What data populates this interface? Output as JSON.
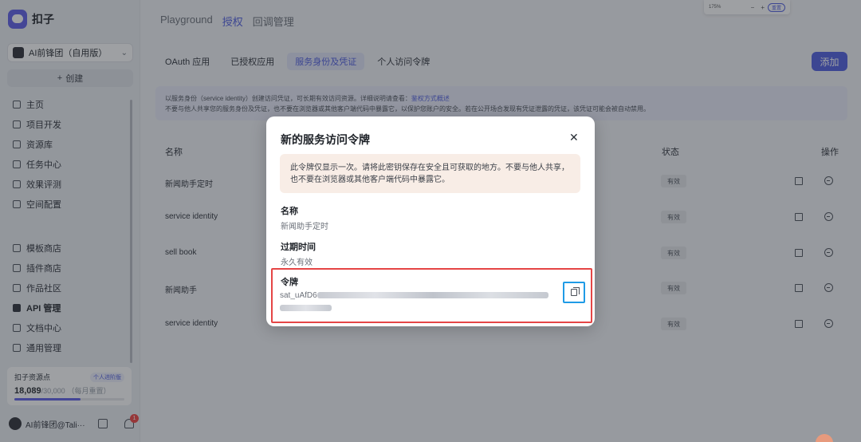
{
  "app": {
    "name": "扣子"
  },
  "workspace": {
    "name": "AI前锋团（自用版）"
  },
  "sidebar": {
    "create_label": "创建",
    "items": [
      {
        "label": "主页",
        "icon": "home-icon"
      },
      {
        "label": "项目开发",
        "icon": "project-icon"
      },
      {
        "label": "资源库",
        "icon": "library-icon"
      },
      {
        "label": "任务中心",
        "icon": "task-icon"
      },
      {
        "label": "效果评测",
        "icon": "evaluation-icon"
      },
      {
        "label": "空间配置",
        "icon": "space-config-icon"
      }
    ],
    "items2": [
      {
        "label": "模板商店",
        "icon": "template-icon"
      },
      {
        "label": "插件商店",
        "icon": "plugin-icon"
      },
      {
        "label": "作品社区",
        "icon": "community-icon"
      },
      {
        "label": "API 管理",
        "icon": "api-icon",
        "active": true
      },
      {
        "label": "文档中心",
        "icon": "docs-icon"
      },
      {
        "label": "通用管理",
        "icon": "settings-icon"
      }
    ],
    "quota": {
      "title": "扣子资源点",
      "badge": "个人进阶版",
      "used": "18,089",
      "total": "/30,000",
      "reset": "（每月重置）",
      "fraction": 0.6
    },
    "user": {
      "name": "AI前锋团@Tali···",
      "notifications": "1"
    }
  },
  "header": {
    "tabs": [
      "Playground",
      "授权",
      "回调管理"
    ],
    "active_tab": "授权",
    "zoom": {
      "value": "175%",
      "minus": "−",
      "plus": "+",
      "reset": "重置"
    }
  },
  "subtabs": {
    "items": [
      "OAuth 应用",
      "已授权应用",
      "服务身份及凭证",
      "个人访问令牌"
    ],
    "active": "服务身份及凭证",
    "add_label": "添加"
  },
  "banner": {
    "line1_prefix": "以服务身份（service identity）创建访问凭证，可长期有效访问资源。详细说明请查看：",
    "line1_link": "鉴权方式概述",
    "line2": "不要与他人共享您的服务身份及凭证，也不要在浏览器或其他客户端代码中暴露它，以保护您账户的安全。若在公开场合发现有凭证泄露的凭证，该凭证可能会被自动禁用。"
  },
  "table": {
    "headers": {
      "name": "名称",
      "status": "状态",
      "actions": "操作"
    },
    "rows": [
      {
        "name": "新闻助手定时",
        "status": "有效"
      },
      {
        "name": "service identity",
        "status": "有效"
      },
      {
        "name": "sell book",
        "status": "有效"
      },
      {
        "name": "新闻助手",
        "status": "有效"
      },
      {
        "name": "service identity",
        "status": "有效"
      }
    ]
  },
  "modal": {
    "title": "新的服务访问令牌",
    "close": "✕",
    "warning": "此令牌仅显示一次。请将此密钥保存在安全且可获取的地方。不要与他人共享，也不要在浏览器或其他客户端代码中暴露它。",
    "name_label": "名称",
    "name_value": "新闻助手定时",
    "expiry_label": "过期时间",
    "expiry_value": "永久有效",
    "token_label": "令牌",
    "token_prefix": "sat_uAfD6"
  }
}
